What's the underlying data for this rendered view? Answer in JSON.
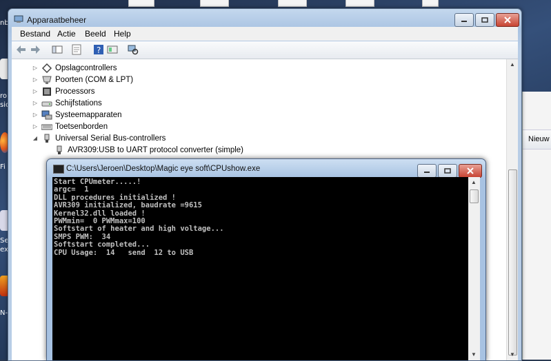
{
  "desktop": {
    "left_labels": [
      "nb",
      "ro",
      "sio",
      "Fi",
      "Se",
      "ex",
      "N-U"
    ]
  },
  "background_window": {
    "column_header": "Nieuw"
  },
  "device_manager": {
    "title": "Apparaatbeheer",
    "menu": [
      "Bestand",
      "Actie",
      "Beeld",
      "Help"
    ],
    "toolbar_icons": [
      "back-icon",
      "forward-icon",
      "show-hide-tree-icon",
      "properties-icon",
      "help-icon",
      "update-driver-icon",
      "scan-hardware-icon"
    ],
    "tree": [
      {
        "label": "Opslagcontrollers",
        "icon": "storage-controller-icon",
        "expanded": false,
        "level": 0
      },
      {
        "label": "Poorten (COM & LPT)",
        "icon": "port-icon",
        "expanded": false,
        "level": 0
      },
      {
        "label": "Processors",
        "icon": "processor-icon",
        "expanded": false,
        "level": 0
      },
      {
        "label": "Schijfstations",
        "icon": "disk-drive-icon",
        "expanded": false,
        "level": 0
      },
      {
        "label": "Systeemapparaten",
        "icon": "system-device-icon",
        "expanded": false,
        "level": 0
      },
      {
        "label": "Toetsenborden",
        "icon": "keyboard-icon",
        "expanded": false,
        "level": 0
      },
      {
        "label": "Universal Serial Bus-controllers",
        "icon": "usb-icon",
        "expanded": true,
        "level": 0
      },
      {
        "label": "AVR309:USB to UART protocol converter (simple)",
        "icon": "usb-device-icon",
        "expanded": null,
        "level": 1
      }
    ]
  },
  "console": {
    "title": "C:\\Users\\Jeroen\\Desktop\\Magic eye soft\\CPUshow.exe",
    "lines": [
      "Start CPUmeter.....!",
      "argc=  1",
      "DLL procedures initialized !",
      "AVR309 initialized, baudrate =9615",
      "Kernel32.dll loaded !",
      "PWMmin=  0 PWMmax=100",
      "Softstart of heater and high voltage...",
      "SMPS PWM:  34",
      "Softstart completed...",
      "CPU Usage:  14   send  12 to USB"
    ]
  },
  "colors": {
    "console_bg": "#000000",
    "console_text": "#c0c0c0",
    "close_button": "#c74433",
    "title_bar": "#a9c3e2"
  }
}
